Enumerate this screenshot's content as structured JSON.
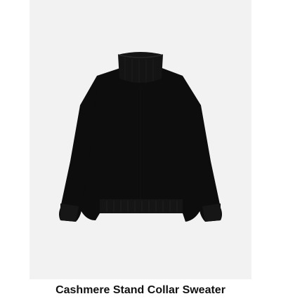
{
  "product": {
    "name": "Cashmere Stand Collar Sweater",
    "image_description_icon": "sweater-image",
    "colors": {
      "background": "#f2f2f2",
      "garment": "#0d0d0d"
    }
  }
}
